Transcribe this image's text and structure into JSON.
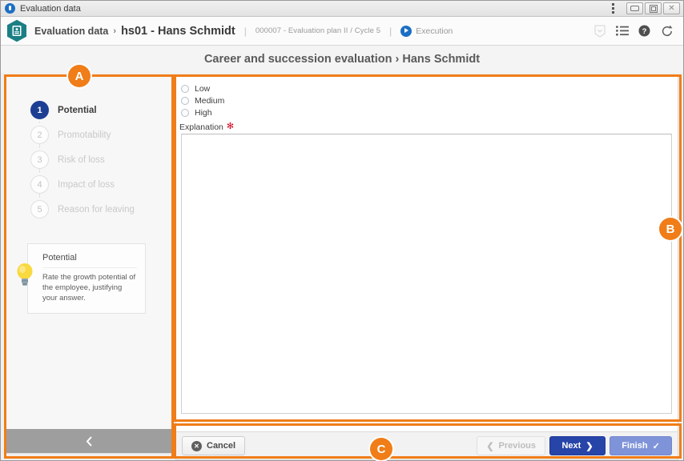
{
  "window": {
    "title": "Evaluation data",
    "app_icon": "app-circle-icon",
    "menu_icon": "kebab-menu-icon",
    "minimize_label": "",
    "maximize_label": "",
    "close_label": "✕"
  },
  "breadcrumb": {
    "module_icon": "id-badge-hexagon-icon",
    "root": "Evaluation data",
    "separator": "›",
    "current": "hs01 - Hans Schmidt",
    "divider": "|",
    "plan": "000007 - Evaluation plan II / Cycle 5",
    "status_icon": "play-circle-icon",
    "status": "Execution",
    "tools": [
      {
        "name": "bookmark-chevron-icon",
        "glyph": "⌄"
      },
      {
        "name": "list-icon",
        "glyph": "☰"
      },
      {
        "name": "help-icon",
        "glyph": "?"
      },
      {
        "name": "refresh-icon",
        "glyph": "↻"
      }
    ]
  },
  "page": {
    "title": "Career and succession evaluation › Hans Schmidt"
  },
  "sidebar": {
    "steps": [
      {
        "number": "1",
        "label": "Potential",
        "state": "active"
      },
      {
        "number": "2",
        "label": "Promotability",
        "state": "idle"
      },
      {
        "number": "3",
        "label": "Risk of loss",
        "state": "idle"
      },
      {
        "number": "4",
        "label": "Impact of loss",
        "state": "idle"
      },
      {
        "number": "5",
        "label": "Reason for leaving",
        "state": "idle"
      }
    ],
    "tip": {
      "icon": "lightbulb-icon",
      "title": "Potential",
      "text": "Rate the growth potential of the employee, justifying your answer."
    },
    "collapse": {
      "icon": "chevron-left-icon",
      "label": ""
    }
  },
  "main": {
    "options": [
      {
        "label": "Low",
        "selected": false
      },
      {
        "label": "Medium",
        "selected": false
      },
      {
        "label": "High",
        "selected": false
      }
    ],
    "explanation": {
      "label": "Explanation",
      "required_marker": "✻",
      "value": "",
      "placeholder": ""
    }
  },
  "footer": {
    "cancel": {
      "label": "Cancel",
      "icon": "close-circle-icon"
    },
    "previous": {
      "label": "Previous",
      "icon": "chevron-left-icon",
      "disabled": true
    },
    "next": {
      "label": "Next",
      "icon": "chevron-right-icon"
    },
    "finish": {
      "label": "Finish",
      "icon": "check-icon"
    }
  },
  "annotations": [
    {
      "label": "A",
      "target": "sidebar-region"
    },
    {
      "label": "B",
      "target": "main-form-region"
    },
    {
      "label": "C",
      "target": "footer-actions-region"
    }
  ],
  "colors": {
    "accent_annotation": "#f07d17",
    "active_step": "#1c3f94",
    "next_button": "#2745a8",
    "finish_button": "#7f94d8",
    "module_icon": "#1a7f84",
    "required": "#d0021b",
    "bulb": "#f6d33c"
  }
}
